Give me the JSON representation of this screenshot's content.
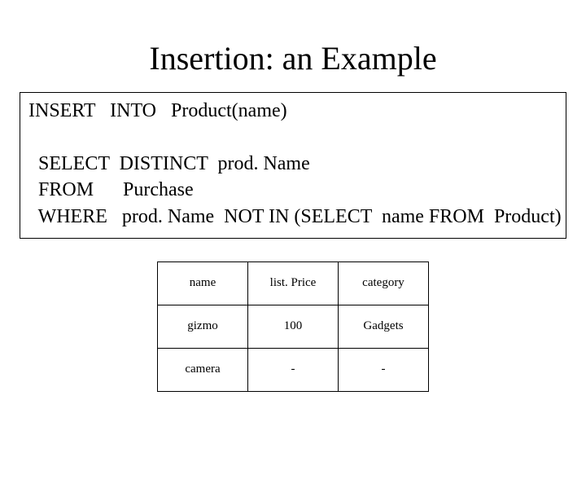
{
  "title": "Insertion: an Example",
  "code": {
    "line1": "INSERT   INTO   Product(name)",
    "line2": "",
    "line3": "  SELECT  DISTINCT  prod. Name",
    "line4": "  FROM      Purchase",
    "line5": "  WHERE   prod. Name  NOT IN (SELECT  name FROM  Product)"
  },
  "table": {
    "headers": [
      "name",
      "list. Price",
      "category"
    ],
    "rows": [
      [
        "gizmo",
        "100",
        "Gadgets"
      ],
      [
        "camera",
        "-",
        "-"
      ]
    ]
  },
  "chart_data": {
    "type": "table",
    "title": "Product table after insertion",
    "columns": [
      "name",
      "list. Price",
      "category"
    ],
    "rows": [
      {
        "name": "gizmo",
        "list. Price": 100,
        "category": "Gadgets"
      },
      {
        "name": "camera",
        "list. Price": null,
        "category": null
      }
    ]
  }
}
